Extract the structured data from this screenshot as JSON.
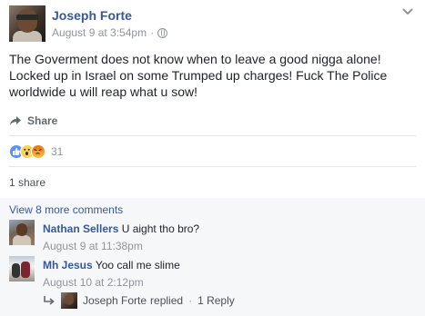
{
  "post": {
    "author": "Joseph Forte",
    "timestamp": "August 9 at 3:54pm",
    "meta_separator": "·",
    "privacy_icon": "globe-icon",
    "menu_icon": "chevron-down-icon",
    "text": "The Goverment does not know when to leave a good nigga alone! Locked up in Israel on some Trumped up charges! Fuck The Police worldwide u will reap what u sow!"
  },
  "actions": {
    "share_label": "Share",
    "share_icon": "share-arrow-icon"
  },
  "reactions": {
    "icons": [
      "like-icon",
      "wow-icon",
      "angry-icon"
    ],
    "count": "31"
  },
  "shares": {
    "label": "1 share"
  },
  "comments": {
    "view_more": "View 8 more comments",
    "items": [
      {
        "author": "Nathan Sellers",
        "text": "U aight tho bro?",
        "timestamp": "August 9 at 11:38pm"
      },
      {
        "author": "Mh Jesus",
        "text": "Yoo call me slime",
        "timestamp": "August 10 at 2:12pm"
      }
    ],
    "reply": {
      "icon": "reply-arrow-icon",
      "author": "Joseph Forte",
      "verb": "replied",
      "separator": "·",
      "count_label": "1 Reply"
    }
  },
  "colors": {
    "link_blue": "#365899",
    "meta_gray": "#90949c",
    "text_dark": "#1d2129",
    "comments_bg": "#f6f7f9",
    "like_blue": "#5890ff",
    "wow_yellow": "#fcd353"
  }
}
